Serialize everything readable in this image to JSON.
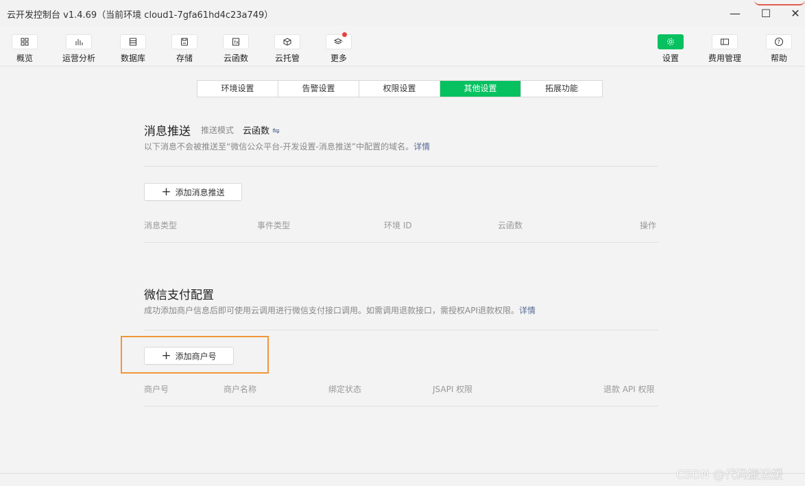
{
  "window": {
    "title": "云开发控制台 v1.4.69（当前环境 cloud1-7gfa61hd4c23a749）",
    "minimize": "—",
    "maximize": "☐",
    "close": "✕"
  },
  "toolbar": {
    "left": [
      {
        "label": "概览",
        "icon": "grid-icon"
      },
      {
        "label": "运营分析",
        "icon": "bar-chart-icon"
      },
      {
        "label": "数据库",
        "icon": "database-icon"
      },
      {
        "label": "存储",
        "icon": "storage-icon"
      },
      {
        "label": "云函数",
        "icon": "function-icon"
      },
      {
        "label": "云托管",
        "icon": "box-icon"
      },
      {
        "label": "更多",
        "icon": "layers-icon"
      }
    ],
    "right": [
      {
        "label": "设置",
        "icon": "gear-icon"
      },
      {
        "label": "费用管理",
        "icon": "billing-icon"
      },
      {
        "label": "帮助",
        "icon": "help-icon"
      }
    ]
  },
  "tabs": [
    "环境设置",
    "告警设置",
    "权限设置",
    "其他设置",
    "拓展功能"
  ],
  "active_tab": "其他设置",
  "push": {
    "title": "消息推送",
    "mode_label": "推送模式",
    "mode_value": "云函数",
    "switch_icon": "⇋",
    "desc": "以下消息不会被推送至“微信公众平台-开发设置-消息推送”中配置的域名。",
    "detail": "详情",
    "add_button": "添加消息推送",
    "columns": [
      "消息类型",
      "事件类型",
      "环境 ID",
      "云函数",
      "操作"
    ]
  },
  "pay": {
    "title": "微信支付配置",
    "desc": "成功添加商户信息后即可使用云调用进行微信支付接口调用。如需调用退款接口，需授权API退款权限。",
    "detail": "详情",
    "add_button": "添加商户号",
    "columns": [
      "商户号",
      "商户名称",
      "绑定状态",
      "JSAPI 权限",
      "退款 API 权限"
    ]
  },
  "watermark": "CSDN @代码搬运媛",
  "colors": {
    "accent": "#07c160",
    "highlight_box": "#f29538",
    "link": "#576b95"
  }
}
